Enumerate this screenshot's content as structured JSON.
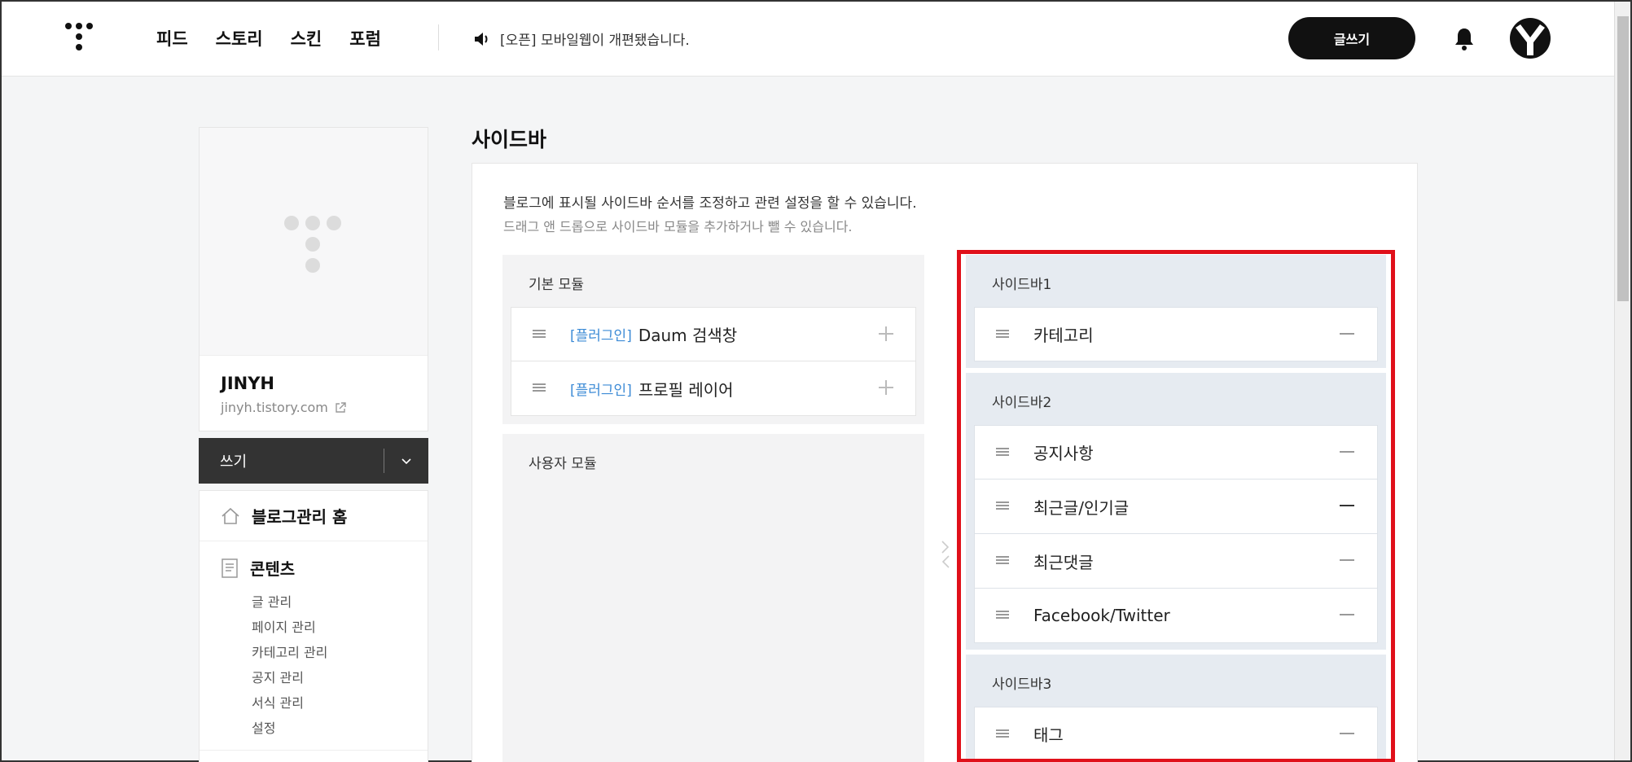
{
  "header": {
    "nav": [
      "피드",
      "스토리",
      "스킨",
      "포럼"
    ],
    "notice": "[오픈] 모바일웹이 개편됐습니다.",
    "write_label": "글쓰기"
  },
  "profile": {
    "name": "JINYH",
    "url": "jinyh.tistory.com"
  },
  "write_bar": {
    "label": "쓰기"
  },
  "menu": {
    "home": "블로그관리 홈",
    "content": {
      "title": "콘텐츠",
      "items": [
        "글 관리",
        "페이지 관리",
        "카테고리 관리",
        "공지 관리",
        "서식 관리",
        "설정"
      ]
    }
  },
  "page": {
    "title": "사이드바",
    "desc1": "블로그에 표시될 사이드바 순서를 조정하고 관련 설정을 할 수 있습니다.",
    "desc2": "드래그 앤 드롭으로 사이드바 모듈을 추가하거나 뺄 수 있습니다."
  },
  "basic_modules": {
    "title": "기본 모듈",
    "items": [
      {
        "tag": "[플러그인]",
        "label": "Daum 검색창"
      },
      {
        "tag": "[플러그인]",
        "label": "프로필 레이어"
      }
    ]
  },
  "user_modules": {
    "title": "사용자 모듈"
  },
  "sidebars": [
    {
      "title": "사이드바1",
      "items": [
        "카테고리"
      ]
    },
    {
      "title": "사이드바2",
      "items": [
        "공지사항",
        "최근글/인기글",
        "최근댓글",
        "Facebook/Twitter"
      ]
    },
    {
      "title": "사이드바3",
      "items": [
        "태그"
      ]
    }
  ],
  "colors": {
    "highlight": "#e0101a",
    "plugin_tag": "#3d8bd6",
    "sidebar_bg": "#e6ebf1"
  }
}
